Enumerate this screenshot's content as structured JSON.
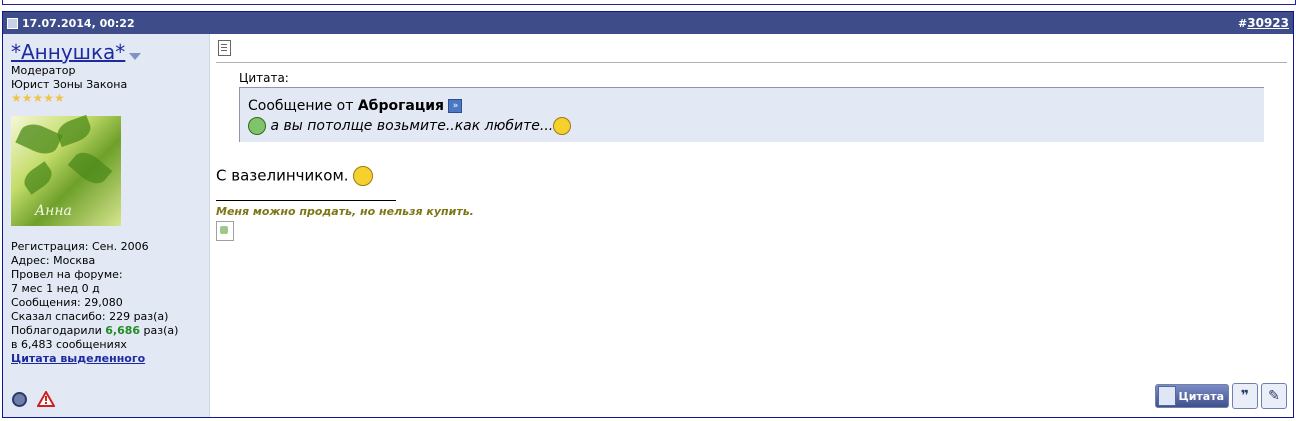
{
  "post": {
    "date": "17.07.2014, 00:22",
    "number_prefix": "#",
    "number": "30923"
  },
  "user": {
    "name": "*Аннушка*",
    "title": "Модератор",
    "subtitle": "Юрист Зоны Закона",
    "stars": "★★★★★",
    "avatar_text": "Aнна",
    "registration": "Регистрация: Сен. 2006",
    "address": "Адрес: Москва",
    "time_label": "Провел на форуме:",
    "time_value": "7 мес 1 нед 0 д",
    "messages": "Сообщения: 29,080",
    "thanks_said": "Сказал спасибо: 229 раз(а)",
    "thanked_prefix": "Поблагодарили",
    "thanked_count": "6,686",
    "thanked_suffix": "раз(а)",
    "thanked_in": "в 6,483 сообщениях",
    "selected_quote": "Цитата выделенного"
  },
  "quote": {
    "label": "Цитата:",
    "prefix": "Сообщение от",
    "author": "Аброгация",
    "text": "а вы потолще возьмите..как любите..."
  },
  "message": {
    "text": "С вазелинчиком."
  },
  "signature": {
    "text": "Меня можно продать, но нельзя купить."
  },
  "actions": {
    "quote_label": "Цитата"
  },
  "colors": {
    "header_bg": "#3e4d8a",
    "sidebar_bg": "#e3e9f4",
    "link": "#1d2ba1",
    "thanks": "#238c23",
    "signature": "#7f7616"
  }
}
